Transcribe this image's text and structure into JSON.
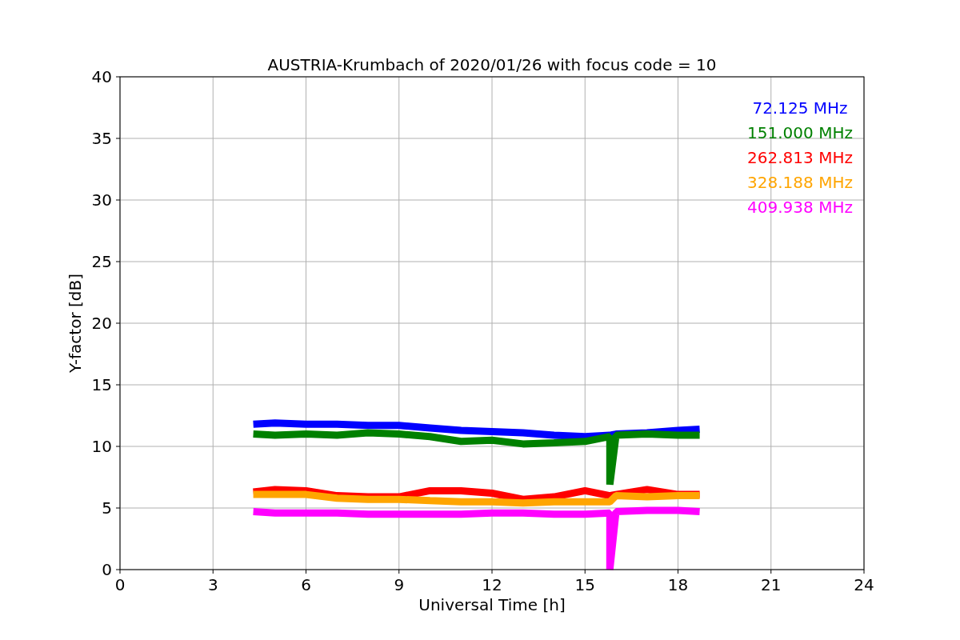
{
  "chart": {
    "chart_data": {
      "type": "line",
      "title": "AUSTRIA-Krumbach of 2020/01/26 with focus code = 10",
      "xlabel": "Universal Time [h]",
      "ylabel": "Y-factor [dB]",
      "x": [
        4.3,
        5,
        6,
        7,
        8,
        9,
        10,
        11,
        12,
        13,
        14,
        15,
        15.8,
        15.8,
        16,
        17,
        18,
        18.7
      ],
      "series": [
        {
          "name": "72.125 MHz",
          "color": "#0000ff",
          "values": [
            11.8,
            11.9,
            11.8,
            11.8,
            11.7,
            11.7,
            11.5,
            11.3,
            11.2,
            11.1,
            10.9,
            10.8,
            10.9,
            10.9,
            11.0,
            11.1,
            11.3,
            11.4
          ]
        },
        {
          "name": "151.000 MHz",
          "color": "#008000",
          "values": [
            11.0,
            10.9,
            11.0,
            10.9,
            11.1,
            11.0,
            10.8,
            10.4,
            10.5,
            10.2,
            10.3,
            10.4,
            10.8,
            6.9,
            10.9,
            11.0,
            10.9,
            10.9
          ]
        },
        {
          "name": "262.813 MHz",
          "color": "#ff0000",
          "values": [
            6.3,
            6.5,
            6.4,
            6.0,
            5.9,
            5.9,
            6.4,
            6.4,
            6.2,
            5.7,
            5.9,
            6.4,
            6.0,
            6.0,
            6.1,
            6.5,
            6.1,
            6.1
          ]
        },
        {
          "name": "328.188 MHz",
          "color": "#ffa500",
          "values": [
            6.1,
            6.1,
            6.1,
            5.8,
            5.7,
            5.7,
            5.6,
            5.5,
            5.5,
            5.4,
            5.5,
            5.5,
            5.5,
            5.5,
            6.0,
            5.9,
            6.0,
            6.0
          ]
        },
        {
          "name": "409.938 MHz",
          "color": "#ff00ff",
          "values": [
            4.7,
            4.6,
            4.6,
            4.6,
            4.5,
            4.5,
            4.5,
            4.5,
            4.6,
            4.6,
            4.5,
            4.5,
            4.6,
            0,
            4.7,
            4.8,
            4.8,
            4.7
          ]
        }
      ],
      "grid": true,
      "xlim": [
        0,
        24
      ],
      "ylim": [
        0,
        40
      ],
      "xticks": [
        0,
        3,
        6,
        9,
        12,
        15,
        18,
        21,
        24
      ],
      "yticks": [
        0,
        5,
        10,
        15,
        20,
        25,
        30,
        35,
        40
      ]
    }
  }
}
